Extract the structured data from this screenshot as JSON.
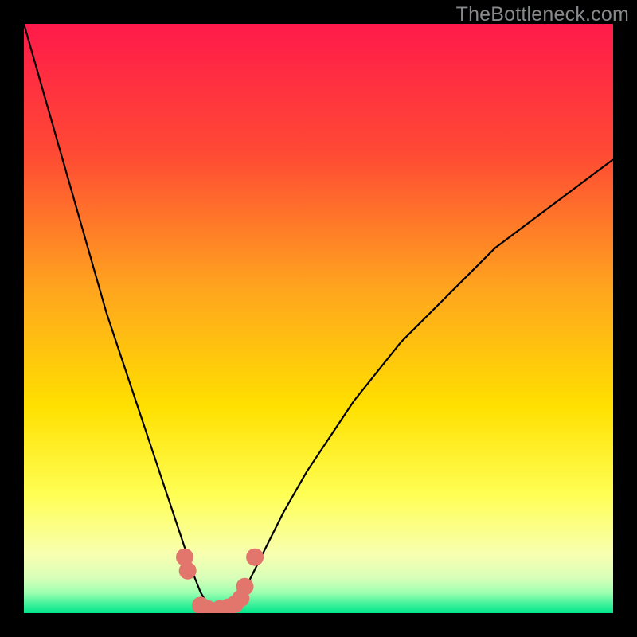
{
  "watermark": "TheBottleneck.com",
  "colors": {
    "frame_bg_black": "#000000",
    "gradient_top": "#ff1a4a",
    "gradient_mid1": "#ff6a2a",
    "gradient_mid2": "#ffd400",
    "gradient_mid3": "#ffff55",
    "gradient_low": "#f8ffb0",
    "gradient_green1": "#7aff9f",
    "gradient_green2": "#00e58c",
    "curve": "#000000",
    "marker_fill": "#e2766d",
    "marker_stroke": "#c45a53"
  },
  "chart_data": {
    "type": "line",
    "title": "",
    "xlabel": "",
    "ylabel": "",
    "xlim": [
      0,
      100
    ],
    "ylim": [
      0,
      100
    ],
    "series": [
      {
        "name": "bottleneck-curve",
        "x": [
          0,
          2,
          4,
          6,
          8,
          10,
          12,
          14,
          16,
          18,
          20,
          22,
          24,
          26,
          27,
          28,
          29,
          30,
          31,
          32,
          33,
          34,
          35,
          36,
          38,
          40,
          44,
          48,
          52,
          56,
          60,
          64,
          68,
          72,
          76,
          80,
          84,
          88,
          92,
          96,
          100
        ],
        "values": [
          100,
          93,
          86,
          79,
          72,
          65,
          58,
          51,
          45,
          39,
          33,
          27,
          21,
          15,
          12,
          9,
          6,
          3.5,
          1.8,
          0.8,
          0.3,
          0.3,
          0.8,
          1.8,
          5,
          9,
          17,
          24,
          30,
          36,
          41,
          46,
          50,
          54,
          58,
          62,
          65,
          68,
          71,
          74,
          77
        ]
      }
    ],
    "markers": [
      {
        "x": 27.3,
        "y": 9.5
      },
      {
        "x": 27.8,
        "y": 7.2
      },
      {
        "x": 30.0,
        "y": 1.3
      },
      {
        "x": 31.2,
        "y": 0.7
      },
      {
        "x": 33.2,
        "y": 0.7
      },
      {
        "x": 34.7,
        "y": 1.0
      },
      {
        "x": 35.8,
        "y": 1.5
      },
      {
        "x": 36.8,
        "y": 2.5
      },
      {
        "x": 37.5,
        "y": 4.5
      },
      {
        "x": 39.2,
        "y": 9.5
      }
    ]
  }
}
